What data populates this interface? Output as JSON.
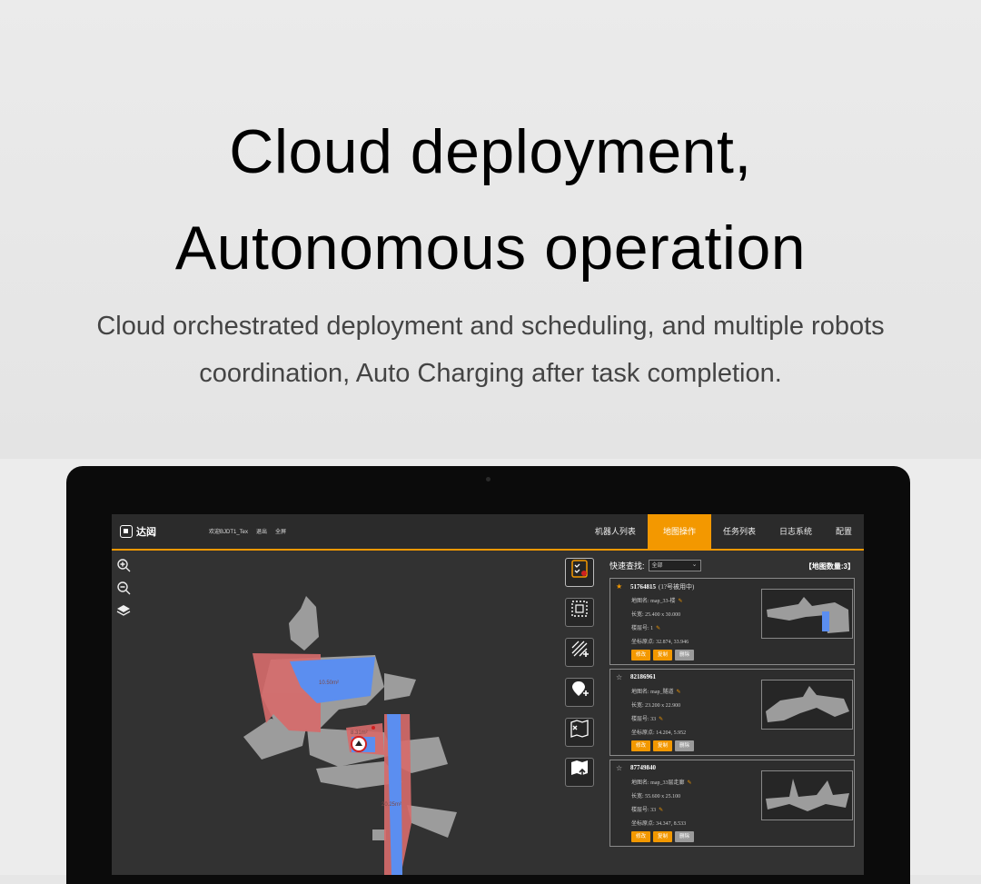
{
  "hero": {
    "title_line1": "Cloud deployment,",
    "title_line2": "Autonomous operation",
    "subtitle_line1": "Cloud orchestrated deployment and scheduling, and multiple robots",
    "subtitle_line2": "coordination, Auto Charging after task completion."
  },
  "app": {
    "brand": "达闼",
    "welcome": "欢迎BJDT1_Tex",
    "logout": "退出",
    "fullscreen": "全屏",
    "nav": [
      {
        "label": "机器人列表",
        "active": false
      },
      {
        "label": "地图操作",
        "active": true
      },
      {
        "label": "任务列表",
        "active": false
      },
      {
        "label": "日志系统",
        "active": false
      },
      {
        "label": "配置",
        "active": false
      }
    ],
    "accent": "#f39800",
    "zoom_tools": [
      "zoom-in-icon",
      "zoom-out-icon",
      "layers-icon"
    ],
    "map_labels": [
      "10.50m²",
      "8.31m²",
      "20.25m²"
    ],
    "tools": [
      "map-checklist-icon",
      "region-select-icon",
      "area-hatch-add-icon",
      "marker-add-icon",
      "map-delete-icon",
      "map-upload-icon"
    ],
    "panel": {
      "search_label": "快速查找:",
      "filter_value": "全部",
      "count": "【地图数量:3】",
      "maps": [
        {
          "id": "51764815",
          "status": "(1?号被用中)",
          "starred": true,
          "name": "地图名: map_33-楼",
          "size": "长宽: 25.400 x 30.000",
          "floor": "楼层号: 1",
          "origin": "坐标原点: 32.874, 33.946",
          "buttons": [
            "修改",
            "复制",
            "删除"
          ]
        },
        {
          "id": "82186961",
          "status": "",
          "starred": false,
          "name": "地图名: map_隧道",
          "size": "长宽: 23.200 x 22.900",
          "floor": "楼层号: 33",
          "origin": "坐标原点: 14.204, 5.952",
          "buttons": [
            "修改",
            "复制",
            "删除"
          ]
        },
        {
          "id": "87749840",
          "status": "",
          "starred": false,
          "name": "地图名: map_33层走廊",
          "size": "长宽: 55.600 x 25.100",
          "floor": "楼层号: 33",
          "origin": "坐标原点: 34.347, 8.533",
          "buttons": [
            "修改",
            "复制",
            "删除"
          ]
        }
      ]
    }
  }
}
